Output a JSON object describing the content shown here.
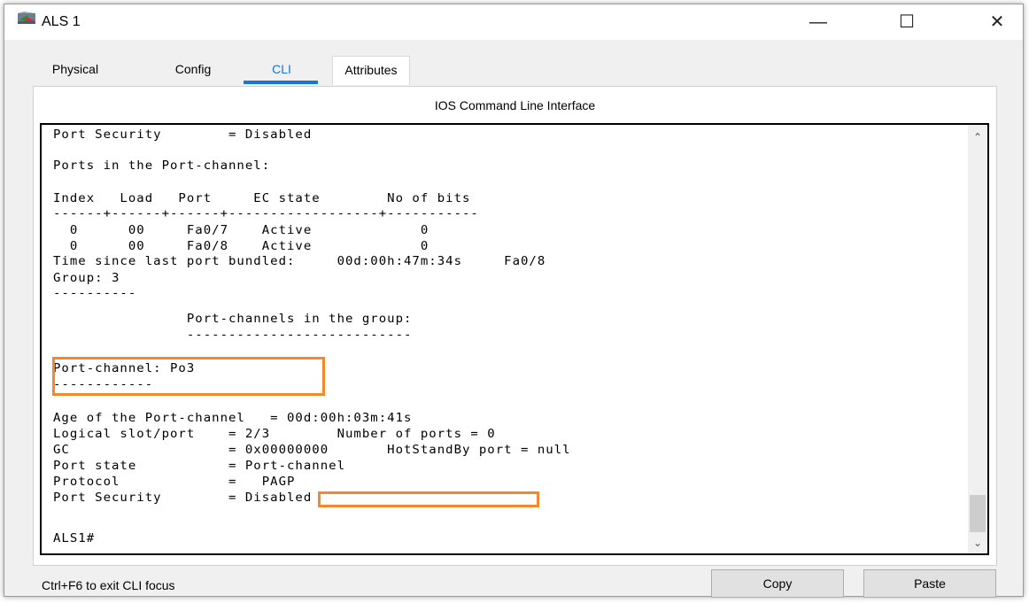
{
  "window": {
    "title": "ALS 1",
    "minimize_glyph": "—",
    "maximize_glyph": "☐",
    "close_glyph": "✕",
    "icon": "router-device-icon"
  },
  "tabs": [
    {
      "label": "Physical"
    },
    {
      "label": "Config"
    },
    {
      "label": "CLI"
    },
    {
      "label": "Attributes"
    }
  ],
  "active_tab": "CLI",
  "panel": {
    "title": "IOS Command Line Interface"
  },
  "terminal": {
    "lines": [
      "Port Security        = Disabled",
      "",
      "Ports in the Port-channel:",
      "",
      "Index   Load   Port     EC state        No of bits",
      "------+------+------+------------------+-----------",
      "  0      00     Fa0/7    Active             0",
      "  0      00     Fa0/8    Active             0",
      "Time since last port bundled:     00d:00h:47m:34s     Fa0/8",
      "Group: 3",
      "----------",
      "                Port-channels in the group:",
      "                ---------------------------",
      "",
      "Port-channel: Po3",
      "------------",
      "",
      "Age of the Port-channel   = 00d:00h:03m:41s",
      "Logical slot/port    = 2/3        Number of ports = 0",
      "GC                   = 0x00000000       HotStandBy port = null",
      "Port state           = Port-channel",
      "Protocol             =   PAGP",
      "Port Security        = Disabled",
      "",
      "ALS1#"
    ]
  },
  "footer": {
    "hint": "Ctrl+F6 to exit CLI focus",
    "copy_label": "Copy",
    "paste_label": "Paste"
  },
  "colors": {
    "accent": "#1a73d9",
    "highlight": "#f5882a"
  }
}
